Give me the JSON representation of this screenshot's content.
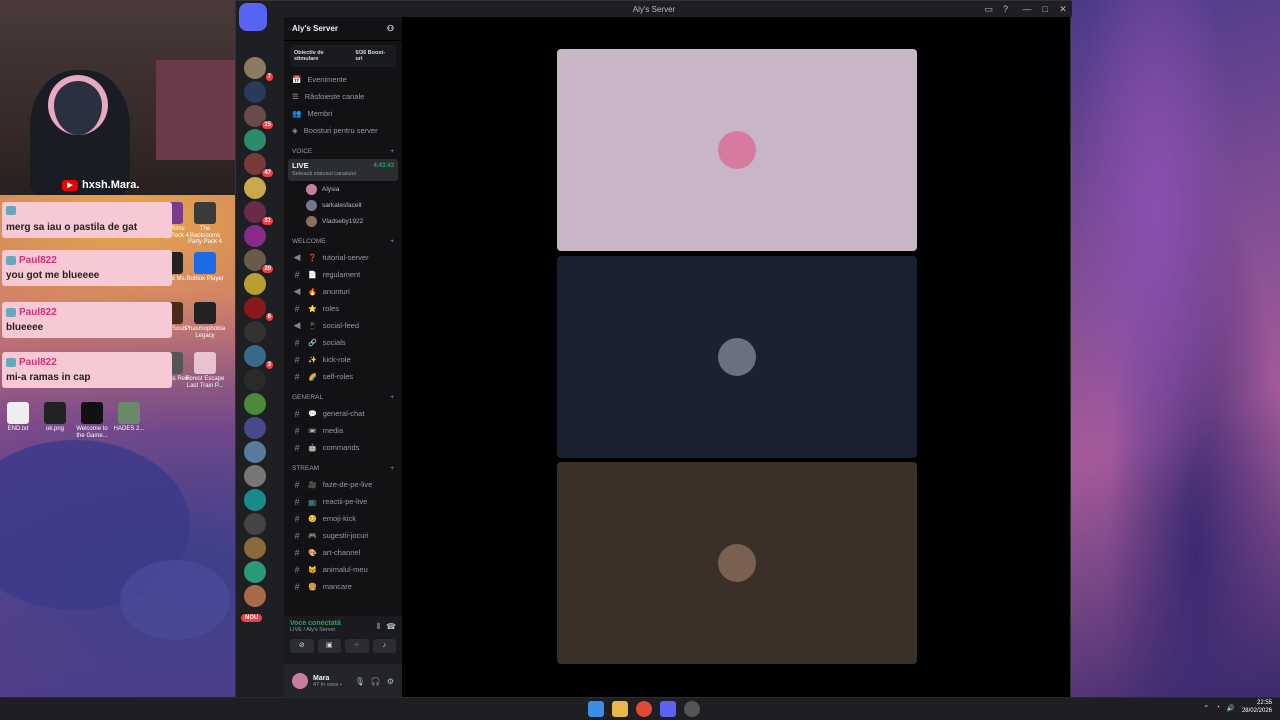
{
  "streamer": {
    "channel_name": "hxsh.Mara."
  },
  "desktop_icons": [
    {
      "label": "The Sims Party Pack 4",
      "color": "#7a3b8a"
    },
    {
      "label": "The Backrooms Party Pack 4",
      "color": "#3b3b3b"
    },
    {
      "label": "Beyond Ms...",
      "color": "#222"
    },
    {
      "label": "Roblox Player",
      "color": "#1d6ae5"
    },
    {
      "label": "Alien Souls",
      "color": "#4a2a1a"
    },
    {
      "label": "Phasmophobia Legacy",
      "color": "#222"
    },
    {
      "label": "Lessons Reiki",
      "color": "#555"
    },
    {
      "label": "Forest Escape Last Train P...",
      "color": "#e8c2d0"
    },
    {
      "label": "END.txt",
      "color": "#eee"
    },
    {
      "label": "ok.png",
      "color": "#222"
    },
    {
      "label": "Welcome to the Game...",
      "color": "#111"
    },
    {
      "label": "HADES 2...",
      "color": "#6a8a6a"
    }
  ],
  "chat": [
    {
      "user": "",
      "text": "merg sa iau o pastila de gat"
    },
    {
      "user": "Paul822",
      "text": "you got me blueeee"
    },
    {
      "user": "Paul822",
      "text": "blueeee"
    },
    {
      "user": "Paul822",
      "text": "mi-a ramas in cap"
    }
  ],
  "window": {
    "title": "Aly's Server",
    "controls": [
      "—",
      "□",
      "✕"
    ]
  },
  "guild_badges": [
    "7",
    "4",
    "15",
    "30",
    "47",
    "42",
    "31",
    "315",
    "20",
    "20",
    "6",
    "9",
    "3",
    "37"
  ],
  "guild_letters": [
    "S",
    "SF"
  ],
  "new_label": "NOU",
  "server": {
    "name": "Aly's Server",
    "boost_goal": "Obiectiv de stimulare",
    "boost_count": "0/36 Boost-uri",
    "menu": [
      "Evenimente",
      "Răsfoiește canale",
      "Membri",
      "Boosturi pentru server"
    ],
    "voice_category": "VOICE",
    "live_channel": "LIVE",
    "live_time": "4:43:43",
    "live_status": "Setează statusul canalului",
    "voice_users": [
      {
        "name": "Alysia",
        "color": "#c77da0"
      },
      {
        "name": "sarkalesfacelt",
        "color": "#778"
      },
      {
        "name": "Vladseby1922",
        "color": "#8a7060"
      }
    ],
    "categories": [
      {
        "name": "WELCOME",
        "channels": [
          {
            "icon": "❓",
            "name": "tutorial-server",
            "type": "voice"
          },
          {
            "icon": "📄",
            "name": "regulament",
            "type": "text"
          },
          {
            "icon": "🔥",
            "name": "anunturi",
            "type": "voice"
          },
          {
            "icon": "⭐",
            "name": "roles",
            "type": "text"
          },
          {
            "icon": "📱",
            "name": "social-feed",
            "type": "voice"
          },
          {
            "icon": "🔗",
            "name": "socials",
            "type": "text"
          },
          {
            "icon": "✨",
            "name": "kick-role",
            "type": "text"
          },
          {
            "icon": "🌈",
            "name": "self-roles",
            "type": "text"
          }
        ]
      },
      {
        "name": "GENERAL",
        "channels": [
          {
            "icon": "💬",
            "name": "general-chat",
            "type": "text"
          },
          {
            "icon": "📼",
            "name": "media",
            "type": "text"
          },
          {
            "icon": "🤖",
            "name": "commands",
            "type": "text"
          }
        ]
      },
      {
        "name": "STREAM",
        "channels": [
          {
            "icon": "🎥",
            "name": "faze-de-pe-live",
            "type": "text"
          },
          {
            "icon": "📺",
            "name": "reactii-pe-live",
            "type": "text"
          },
          {
            "icon": "😊",
            "name": "emoji-kick",
            "type": "text"
          },
          {
            "icon": "🎮",
            "name": "sugestii-jocuri",
            "type": "text"
          },
          {
            "icon": "🎨",
            "name": "art-channel",
            "type": "text"
          },
          {
            "icon": "🐱",
            "name": "animalul-meu",
            "type": "text"
          },
          {
            "icon": "🍔",
            "name": "mancare",
            "type": "text"
          }
        ]
      }
    ]
  },
  "voice_panel": {
    "status": "Voce conectată",
    "channel": "LIVE / Aly's Server"
  },
  "user": {
    "name": "Mara",
    "status": "47 în voce •"
  },
  "stage_tiles": [
    {
      "bg": "#c8b6c8",
      "avatar": "#d67aa0"
    },
    {
      "bg": "#1b2130",
      "avatar": "#6a7080"
    },
    {
      "bg": "#3a3028",
      "avatar": "#7a6050"
    }
  ],
  "taskbar": {
    "time": "22:55",
    "date": "28/02/2026"
  }
}
